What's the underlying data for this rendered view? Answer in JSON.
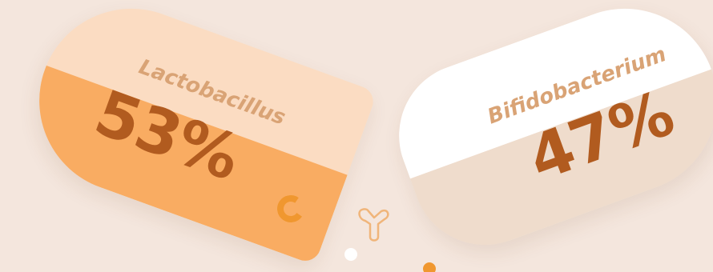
{
  "cards": [
    {
      "label": "Lactobacillus",
      "percent": "53%",
      "value": 53,
      "colors": {
        "top": "#fbdcc2",
        "bottom": "#f9ac62"
      }
    },
    {
      "label": "Bifidobacterium",
      "percent": "47%",
      "value": 47,
      "colors": {
        "top": "#ffffff",
        "bottom": "#efdccc"
      }
    }
  ],
  "palette": {
    "background": "#f4e6dd",
    "label_text": "#d9a375",
    "percent_text": "#b15b1f",
    "accent": "#f0972f"
  },
  "decorations": [
    "c-shape",
    "y-shape-icon",
    "white-dot",
    "orange-dot"
  ]
}
